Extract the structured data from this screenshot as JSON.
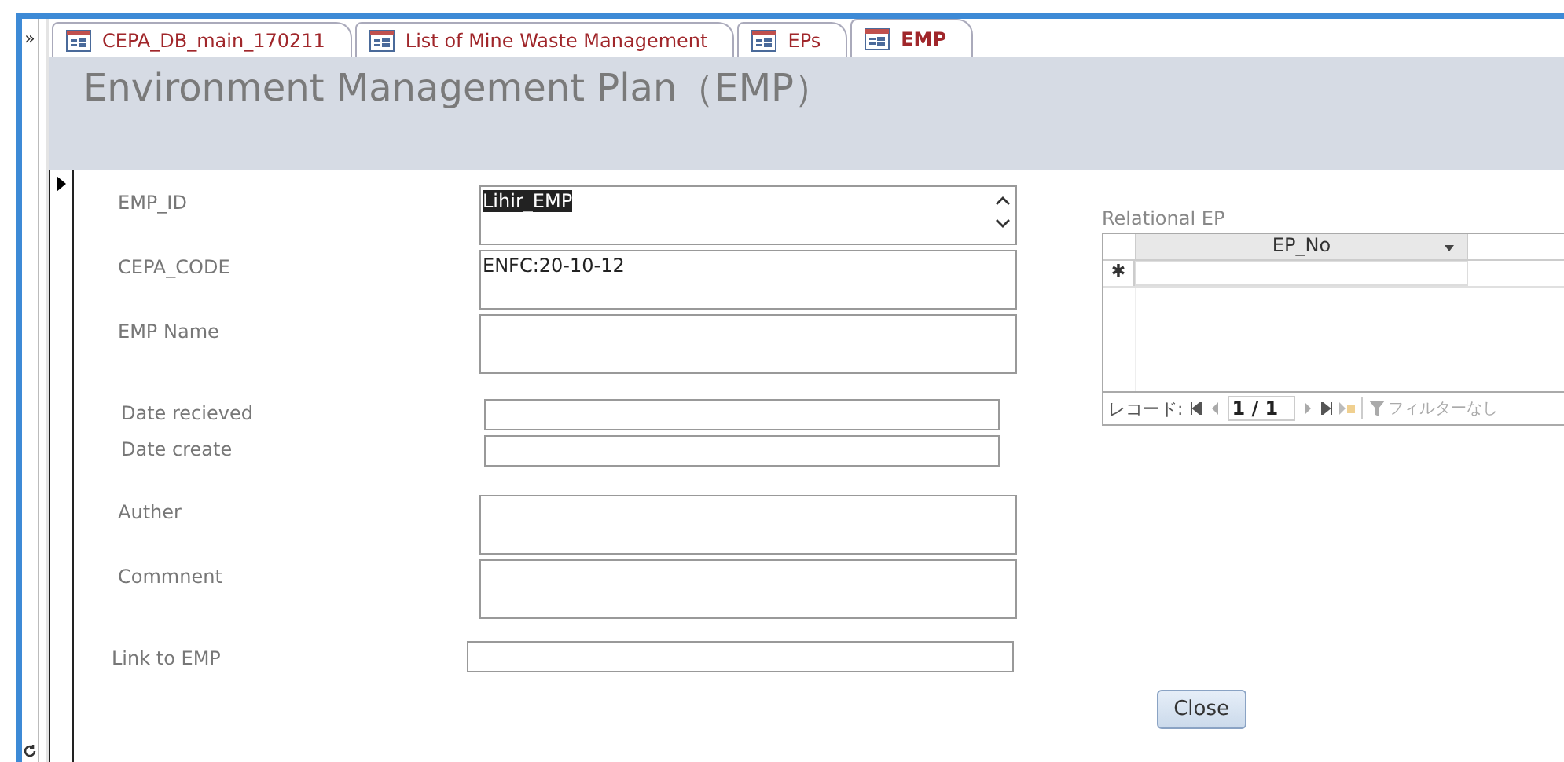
{
  "nav_pane": {
    "toggle": "»"
  },
  "tabs": [
    {
      "label": "CEPA_DB_main_170211",
      "selected": false
    },
    {
      "label": "List of Mine Waste Management",
      "selected": false
    },
    {
      "label": "EPs",
      "selected": false
    },
    {
      "label": "EMP",
      "selected": true
    }
  ],
  "form": {
    "title": "Environment Management Plan（EMP）",
    "fields": [
      {
        "label": "EMP_ID",
        "kind": "scroll",
        "value": "Lihir_EMP",
        "highlighted": true
      },
      {
        "label": "CEPA_CODE",
        "kind": "tall",
        "value": "ENFC:20-10-12",
        "highlighted": false
      },
      {
        "label": "EMP  Name",
        "kind": "tall"
      },
      {
        "label": "Date recieved",
        "kind": "short"
      },
      {
        "label": "Date create",
        "kind": "short"
      },
      {
        "label": "Auther",
        "kind": "tall"
      },
      {
        "label": "Commnent",
        "kind": "tall"
      },
      {
        "label": "Link to EMP",
        "kind": "short"
      }
    ],
    "subform": {
      "label": "Relational EP",
      "column": "EP_No",
      "new_row_marker": "✱",
      "record_label": "レコード:",
      "record_position": "1 / 1",
      "filter": "フィルターなし"
    },
    "close_button": "Close"
  }
}
